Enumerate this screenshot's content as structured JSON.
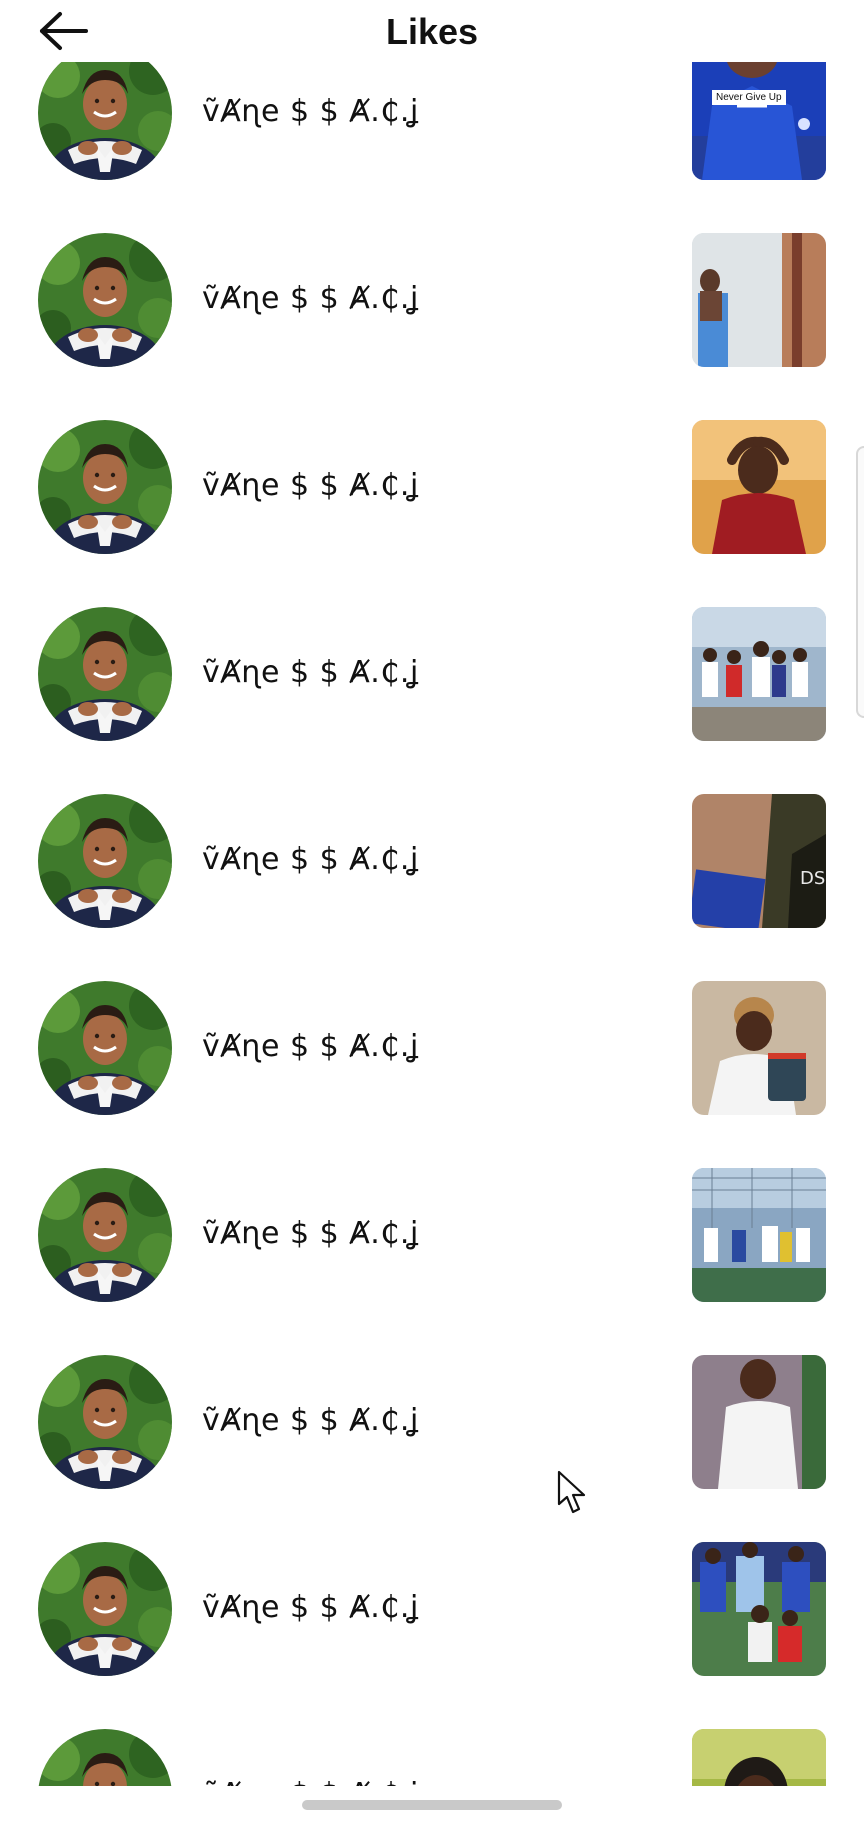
{
  "header": {
    "title": "Likes",
    "back_icon": "arrow-left-icon"
  },
  "likes": [
    {
      "username": "ṽȺɳe $ $ Ⱥ.₵.ʝ",
      "thumbnail": "blue-jersey-thumbnail",
      "thumbnail_caption": "Never Give Up"
    },
    {
      "username": "ṽȺɳe $ $ Ⱥ.₵.ʝ",
      "thumbnail": "doorway-thumbnail",
      "thumbnail_caption": ""
    },
    {
      "username": "ṽȺɳe $ $ Ⱥ.₵.ʝ",
      "thumbnail": "red-jacket-thumbnail",
      "thumbnail_caption": ""
    },
    {
      "username": "ṽȺɳe $ $ Ⱥ.₵.ʝ",
      "thumbnail": "group-dance-thumbnail",
      "thumbnail_caption": ""
    },
    {
      "username": "ṽȺɳe $ $ Ⱥ.₵.ʝ",
      "thumbnail": "closeup-box-thumbnail",
      "thumbnail_caption": ""
    },
    {
      "username": "ṽȺɳe $ $ Ⱥ.₵.ʝ",
      "thumbnail": "mug-holder-thumbnail",
      "thumbnail_caption": ""
    },
    {
      "username": "ṽȺɳe $ $ Ⱥ.₵.ʝ",
      "thumbnail": "football-group-thumbnail",
      "thumbnail_caption": ""
    },
    {
      "username": "ṽȺɳe $ $ Ⱥ.₵.ʝ",
      "thumbnail": "white-shirt-thumbnail",
      "thumbnail_caption": ""
    },
    {
      "username": "ṽȺɳe $ $ Ⱥ.₵.ʝ",
      "thumbnail": "jerseys-group-thumbnail",
      "thumbnail_caption": ""
    },
    {
      "username": "ṽȺɳe $ $ Ⱥ.₵.ʝ",
      "thumbnail": "smiling-man-thumbnail",
      "thumbnail_caption": ""
    }
  ],
  "colors": {
    "background": "#ffffff",
    "text": "#111111",
    "home_indicator": "#c9c9c9"
  }
}
